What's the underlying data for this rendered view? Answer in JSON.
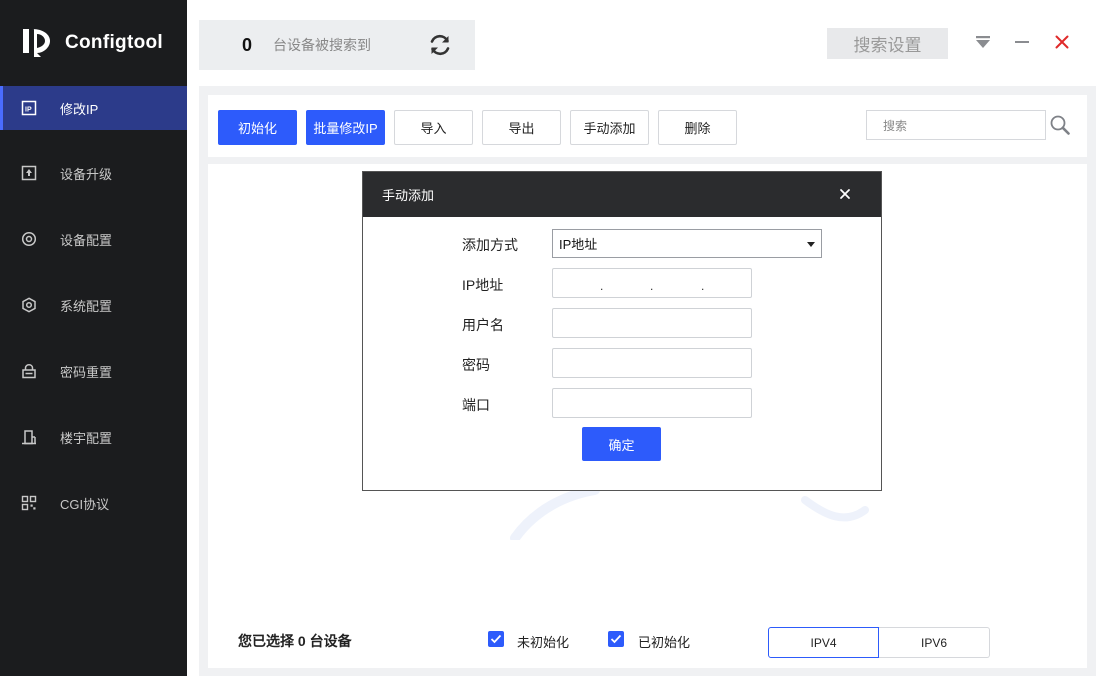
{
  "app": {
    "title": "Configtool"
  },
  "sidebar": {
    "items": [
      {
        "label": "修改IP",
        "icon": "ip-icon",
        "active": true
      },
      {
        "label": "设备升级",
        "icon": "upgrade-icon",
        "active": false
      },
      {
        "label": "设备配置",
        "icon": "device-config-icon",
        "active": false
      },
      {
        "label": "系统配置",
        "icon": "system-config-icon",
        "active": false
      },
      {
        "label": "密码重置",
        "icon": "password-reset-icon",
        "active": false
      },
      {
        "label": "楼宇配置",
        "icon": "building-icon",
        "active": false
      },
      {
        "label": "CGI协议",
        "icon": "cgi-icon",
        "active": false
      }
    ]
  },
  "header": {
    "device_count": "0",
    "device_count_label": "台设备被搜索到",
    "search_settings_label": "搜索设置"
  },
  "toolbar": {
    "init_label": "初始化",
    "batch_modify_label": "批量修改IP",
    "import_label": "导入",
    "export_label": "导出",
    "manual_add_label": "手动添加",
    "delete_label": "删除",
    "search_placeholder": "搜索"
  },
  "footer": {
    "selected_prefix": "您已选择",
    "selected_count": "0",
    "selected_suffix": "台设备",
    "uninitialized_label": "未初始化",
    "initialized_label": "已初始化",
    "ipv4_label": "IPV4",
    "ipv6_label": "IPV6"
  },
  "dialog": {
    "title": "手动添加",
    "add_method_label": "添加方式",
    "add_method_value": "IP地址",
    "ip_label": "IP地址",
    "username_label": "用户名",
    "password_label": "密码",
    "port_label": "端口",
    "confirm_label": "确定"
  },
  "colors": {
    "accent": "#2d5bfb",
    "sidebar_bg": "#1b1c1e",
    "active_nav_bg": "#2c3b8a",
    "close_red": "#e02a2a"
  }
}
